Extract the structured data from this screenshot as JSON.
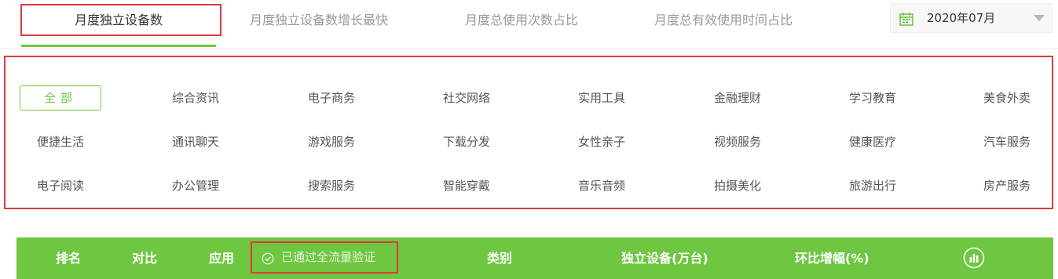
{
  "tabs": [
    {
      "label": "月度独立设备数"
    },
    {
      "label": "月度独立设备数增长最快"
    },
    {
      "label": "月度总使用次数占比"
    },
    {
      "label": "月度总有效使用时间占比"
    }
  ],
  "date_picker": {
    "value": "2020年07月"
  },
  "categories": [
    {
      "label": "全部"
    },
    {
      "label": "综合资讯"
    },
    {
      "label": "电子商务"
    },
    {
      "label": "社交网络"
    },
    {
      "label": "实用工具"
    },
    {
      "label": "金融理财"
    },
    {
      "label": "学习教育"
    },
    {
      "label": "美食外卖"
    },
    {
      "label": "便捷生活"
    },
    {
      "label": "通讯聊天"
    },
    {
      "label": "游戏服务"
    },
    {
      "label": "下载分发"
    },
    {
      "label": "女性亲子"
    },
    {
      "label": "视频服务"
    },
    {
      "label": "健康医疗"
    },
    {
      "label": "汽车服务"
    },
    {
      "label": "电子阅读"
    },
    {
      "label": "办公管理"
    },
    {
      "label": "搜索服务"
    },
    {
      "label": "智能穿戴"
    },
    {
      "label": "音乐音频"
    },
    {
      "label": "拍摄美化"
    },
    {
      "label": "旅游出行"
    },
    {
      "label": "房产服务"
    }
  ],
  "list_header": {
    "rank": "排名",
    "compare": "对比",
    "app": "应用",
    "verified": "已通过全流量验证",
    "category": "类别",
    "devices": "独立设备(万台)",
    "mom_growth": "环比增幅(%)"
  },
  "colors": {
    "accent": "#6ec641",
    "highlight": "#e03a3a"
  }
}
